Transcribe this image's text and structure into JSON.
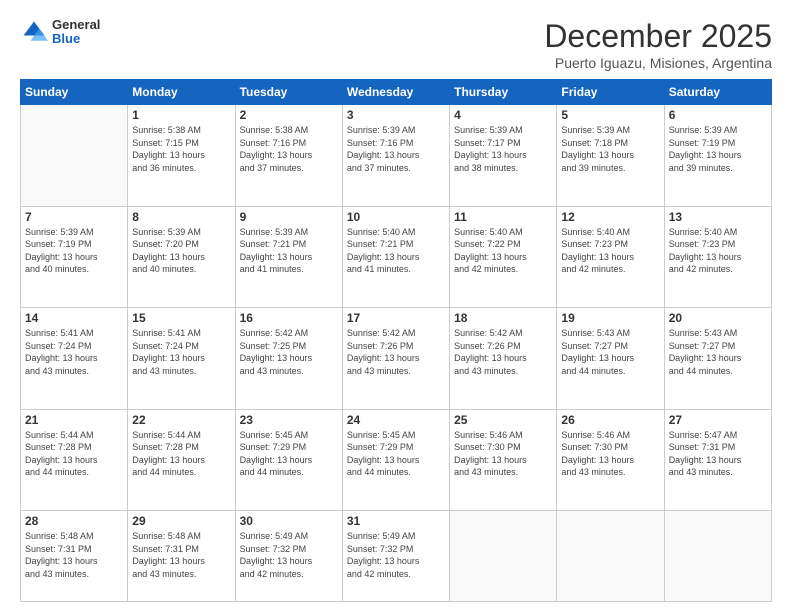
{
  "logo": {
    "general": "General",
    "blue": "Blue"
  },
  "header": {
    "title": "December 2025",
    "subtitle": "Puerto Iguazu, Misiones, Argentina"
  },
  "weekdays": [
    "Sunday",
    "Monday",
    "Tuesday",
    "Wednesday",
    "Thursday",
    "Friday",
    "Saturday"
  ],
  "weeks": [
    [
      {
        "day": "",
        "info": ""
      },
      {
        "day": "1",
        "info": "Sunrise: 5:38 AM\nSunset: 7:15 PM\nDaylight: 13 hours\nand 36 minutes."
      },
      {
        "day": "2",
        "info": "Sunrise: 5:38 AM\nSunset: 7:16 PM\nDaylight: 13 hours\nand 37 minutes."
      },
      {
        "day": "3",
        "info": "Sunrise: 5:39 AM\nSunset: 7:16 PM\nDaylight: 13 hours\nand 37 minutes."
      },
      {
        "day": "4",
        "info": "Sunrise: 5:39 AM\nSunset: 7:17 PM\nDaylight: 13 hours\nand 38 minutes."
      },
      {
        "day": "5",
        "info": "Sunrise: 5:39 AM\nSunset: 7:18 PM\nDaylight: 13 hours\nand 39 minutes."
      },
      {
        "day": "6",
        "info": "Sunrise: 5:39 AM\nSunset: 7:19 PM\nDaylight: 13 hours\nand 39 minutes."
      }
    ],
    [
      {
        "day": "7",
        "info": "Sunrise: 5:39 AM\nSunset: 7:19 PM\nDaylight: 13 hours\nand 40 minutes."
      },
      {
        "day": "8",
        "info": "Sunrise: 5:39 AM\nSunset: 7:20 PM\nDaylight: 13 hours\nand 40 minutes."
      },
      {
        "day": "9",
        "info": "Sunrise: 5:39 AM\nSunset: 7:21 PM\nDaylight: 13 hours\nand 41 minutes."
      },
      {
        "day": "10",
        "info": "Sunrise: 5:40 AM\nSunset: 7:21 PM\nDaylight: 13 hours\nand 41 minutes."
      },
      {
        "day": "11",
        "info": "Sunrise: 5:40 AM\nSunset: 7:22 PM\nDaylight: 13 hours\nand 42 minutes."
      },
      {
        "day": "12",
        "info": "Sunrise: 5:40 AM\nSunset: 7:23 PM\nDaylight: 13 hours\nand 42 minutes."
      },
      {
        "day": "13",
        "info": "Sunrise: 5:40 AM\nSunset: 7:23 PM\nDaylight: 13 hours\nand 42 minutes."
      }
    ],
    [
      {
        "day": "14",
        "info": "Sunrise: 5:41 AM\nSunset: 7:24 PM\nDaylight: 13 hours\nand 43 minutes."
      },
      {
        "day": "15",
        "info": "Sunrise: 5:41 AM\nSunset: 7:24 PM\nDaylight: 13 hours\nand 43 minutes."
      },
      {
        "day": "16",
        "info": "Sunrise: 5:42 AM\nSunset: 7:25 PM\nDaylight: 13 hours\nand 43 minutes."
      },
      {
        "day": "17",
        "info": "Sunrise: 5:42 AM\nSunset: 7:26 PM\nDaylight: 13 hours\nand 43 minutes."
      },
      {
        "day": "18",
        "info": "Sunrise: 5:42 AM\nSunset: 7:26 PM\nDaylight: 13 hours\nand 43 minutes."
      },
      {
        "day": "19",
        "info": "Sunrise: 5:43 AM\nSunset: 7:27 PM\nDaylight: 13 hours\nand 44 minutes."
      },
      {
        "day": "20",
        "info": "Sunrise: 5:43 AM\nSunset: 7:27 PM\nDaylight: 13 hours\nand 44 minutes."
      }
    ],
    [
      {
        "day": "21",
        "info": "Sunrise: 5:44 AM\nSunset: 7:28 PM\nDaylight: 13 hours\nand 44 minutes."
      },
      {
        "day": "22",
        "info": "Sunrise: 5:44 AM\nSunset: 7:28 PM\nDaylight: 13 hours\nand 44 minutes."
      },
      {
        "day": "23",
        "info": "Sunrise: 5:45 AM\nSunset: 7:29 PM\nDaylight: 13 hours\nand 44 minutes."
      },
      {
        "day": "24",
        "info": "Sunrise: 5:45 AM\nSunset: 7:29 PM\nDaylight: 13 hours\nand 44 minutes."
      },
      {
        "day": "25",
        "info": "Sunrise: 5:46 AM\nSunset: 7:30 PM\nDaylight: 13 hours\nand 43 minutes."
      },
      {
        "day": "26",
        "info": "Sunrise: 5:46 AM\nSunset: 7:30 PM\nDaylight: 13 hours\nand 43 minutes."
      },
      {
        "day": "27",
        "info": "Sunrise: 5:47 AM\nSunset: 7:31 PM\nDaylight: 13 hours\nand 43 minutes."
      }
    ],
    [
      {
        "day": "28",
        "info": "Sunrise: 5:48 AM\nSunset: 7:31 PM\nDaylight: 13 hours\nand 43 minutes."
      },
      {
        "day": "29",
        "info": "Sunrise: 5:48 AM\nSunset: 7:31 PM\nDaylight: 13 hours\nand 43 minutes."
      },
      {
        "day": "30",
        "info": "Sunrise: 5:49 AM\nSunset: 7:32 PM\nDaylight: 13 hours\nand 42 minutes."
      },
      {
        "day": "31",
        "info": "Sunrise: 5:49 AM\nSunset: 7:32 PM\nDaylight: 13 hours\nand 42 minutes."
      },
      {
        "day": "",
        "info": ""
      },
      {
        "day": "",
        "info": ""
      },
      {
        "day": "",
        "info": ""
      }
    ]
  ]
}
